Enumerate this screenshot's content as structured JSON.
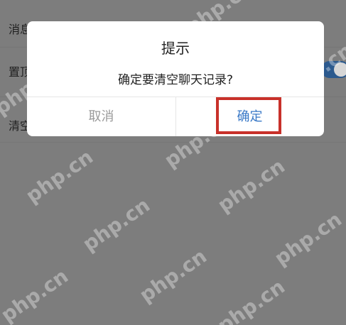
{
  "background": {
    "rows": [
      {
        "label": "消息"
      },
      {
        "label": "置顶"
      },
      {
        "label": "清空"
      }
    ],
    "toggle_on": true
  },
  "dialog": {
    "title": "提示",
    "message": "确定要清空聊天记录?",
    "cancel_label": "取消",
    "confirm_label": "确定"
  },
  "colors": {
    "overlay": "#7d7d7d",
    "dialog_bg": "#ffffff",
    "confirm_text": "#3a79c7",
    "cancel_text": "#9a9a9a",
    "highlight": "#c8312a",
    "toggle": "#2c5a8e"
  },
  "watermark": {
    "text": "php.cn"
  }
}
